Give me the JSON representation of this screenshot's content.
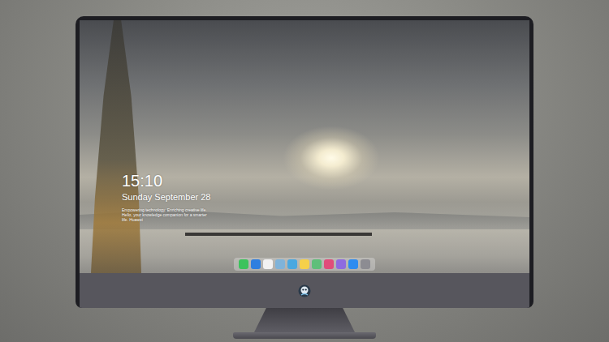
{
  "screen": {
    "kind": "lock-screen",
    "clock": {
      "time": "15:10",
      "date": "Sunday September 28",
      "caption": "Empowering technology. Enriching creative life. Hello, your knowledge companion for a smarter life. Huawei"
    }
  },
  "dock": {
    "items": [
      {
        "color": "#3cc35c"
      },
      {
        "color": "#2f7fe0"
      },
      {
        "color": "#f2f2f2"
      },
      {
        "color": "#7fb3d9"
      },
      {
        "color": "#4aa8e0"
      },
      {
        "color": "#f5d04a"
      },
      {
        "color": "#5fbf7a"
      },
      {
        "color": "#e04d7a"
      },
      {
        "color": "#8e6be0"
      },
      {
        "color": "#2d8cf0"
      },
      {
        "color": "#8c8c92"
      }
    ]
  }
}
